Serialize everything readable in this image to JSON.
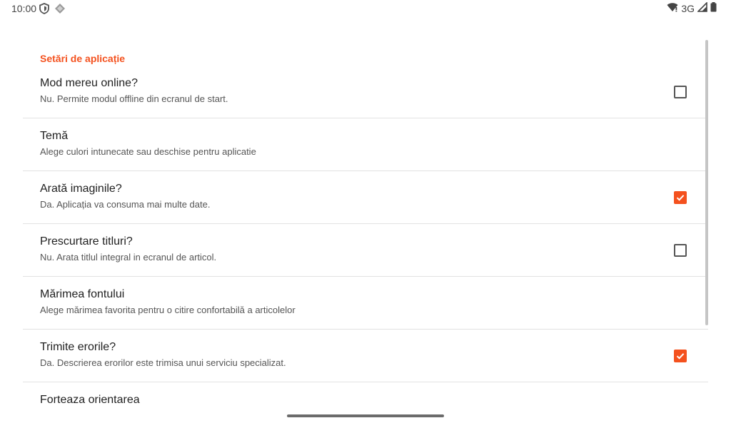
{
  "status_bar": {
    "time": "10:00",
    "network": "3G",
    "icons": [
      "vpn-shield-icon",
      "app-notification-icon",
      "wifi-icon",
      "signal-icon",
      "battery-icon"
    ]
  },
  "settings": {
    "category": "Setări de aplicație",
    "items": [
      {
        "title": "Mod mereu online?",
        "summary": "Nu. Permite modul offline din ecranul de start.",
        "checkbox": true,
        "checked": false
      },
      {
        "title": "Temă",
        "summary": "Alege culori intunecate sau deschise pentru aplicatie",
        "checkbox": false
      },
      {
        "title": "Arată imaginile?",
        "summary": "Da. Aplicația va consuma mai multe date.",
        "checkbox": true,
        "checked": true
      },
      {
        "title": "Prescurtare titluri?",
        "summary": "Nu. Arata titlul integral in ecranul de articol.",
        "checkbox": true,
        "checked": false
      },
      {
        "title": "Mărimea fontului",
        "summary": "Alege mărimea favorita pentru o citire confortabilă a articolelor",
        "checkbox": false
      },
      {
        "title": "Trimite erorile?",
        "summary": "Da. Descrierea erorilor este trimisa unui serviciu specializat.",
        "checkbox": true,
        "checked": true
      },
      {
        "title": "Forteaza orientarea",
        "summary": "",
        "checkbox": false
      }
    ]
  },
  "colors": {
    "accent": "#f4511e"
  }
}
